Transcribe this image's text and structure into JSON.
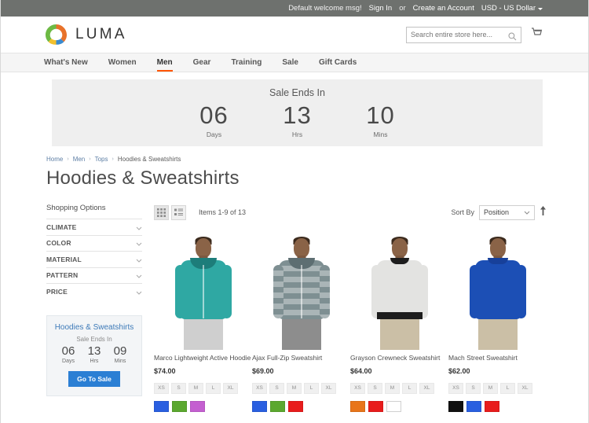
{
  "top_panel": {
    "welcome": "Default welcome msg!",
    "sign_in": "Sign In",
    "or": "or",
    "create_account": "Create an Account",
    "currency": "USD - US Dollar"
  },
  "header": {
    "logo_text": "LUMA",
    "search_placeholder": "Search entire store here...",
    "cart_icon": "cart-icon",
    "search_icon": "search-icon"
  },
  "nav": {
    "items": [
      {
        "label": "What's New",
        "active": false
      },
      {
        "label": "Women",
        "active": false
      },
      {
        "label": "Men",
        "active": true
      },
      {
        "label": "Gear",
        "active": false
      },
      {
        "label": "Training",
        "active": false
      },
      {
        "label": "Sale",
        "active": false
      },
      {
        "label": "Gift Cards",
        "active": false
      }
    ],
    "active_color": "#ff5501"
  },
  "banner": {
    "title": "Sale Ends In",
    "countdown": [
      {
        "value": "06",
        "label": "Days"
      },
      {
        "value": "13",
        "label": "Hrs"
      },
      {
        "value": "10",
        "label": "Mins"
      }
    ]
  },
  "breadcrumbs": {
    "items": [
      "Home",
      "Men",
      "Tops",
      "Hoodies & Sweatshirts"
    ],
    "separator": "›"
  },
  "page_title": "Hoodies & Sweatshirts",
  "sidebar": {
    "heading": "Shopping Options",
    "filters": [
      {
        "label": "CLIMATE"
      },
      {
        "label": "COLOR"
      },
      {
        "label": "MATERIAL"
      },
      {
        "label": "PATTERN"
      },
      {
        "label": "PRICE"
      }
    ],
    "promo": {
      "title": "Hoodies & Sweatshirts",
      "subtitle": "Sale Ends In",
      "countdown": [
        {
          "value": "06",
          "label": "Days"
        },
        {
          "value": "13",
          "label": "Hrs"
        },
        {
          "value": "09",
          "label": "Mins"
        }
      ],
      "button": "Go To Sale",
      "button_color": "#2b7fd4"
    }
  },
  "toolbar": {
    "grid_mode_icon": "grid-view-icon",
    "list_mode_icon": "list-view-icon",
    "active_mode": "grid",
    "count_text": "Items 1-9 of 13",
    "sort_label": "Sort By",
    "sort_value": "Position",
    "sort_direction_icon": "sort-ascending-icon"
  },
  "products": [
    {
      "name": "Marco Lightweight Active Hoodie",
      "price": "$74.00",
      "sizes": [
        "XS",
        "S",
        "M",
        "L",
        "XL"
      ],
      "swatches": [
        "#2a5fe0",
        "#5ba82f",
        "#c45fd0"
      ],
      "garment_color": "#2fa8a3",
      "garment_type": "hoodie",
      "pants": "light"
    },
    {
      "name": "Ajax Full-Zip Sweatshirt",
      "price": "$69.00",
      "sizes": [
        "XS",
        "S",
        "M",
        "L",
        "XL"
      ],
      "swatches": [
        "#2a5fe0",
        "#5ba82f",
        "#e81c1c"
      ],
      "garment_color": "#7e8f92",
      "garment_type": "striped-hoodie",
      "pants": "dark"
    },
    {
      "name": "Grayson Crewneck Sweatshirt",
      "price": "$64.00",
      "sizes": [
        "XS",
        "S",
        "M",
        "L",
        "XL"
      ],
      "swatches": [
        "#e8751a",
        "#e81c1c",
        "#ffffff"
      ],
      "garment_color": "#e3e3e1",
      "garment_type": "crewneck",
      "pants": "khaki"
    },
    {
      "name": "Mach Street Sweatshirt",
      "price": "$62.00",
      "sizes": [
        "XS",
        "S",
        "M",
        "L",
        "XL"
      ],
      "swatches": [
        "#111111",
        "#2a5fe0",
        "#e81c1c"
      ],
      "garment_color": "#1c4fb5",
      "garment_type": "crewneck",
      "pants": "khaki"
    }
  ]
}
